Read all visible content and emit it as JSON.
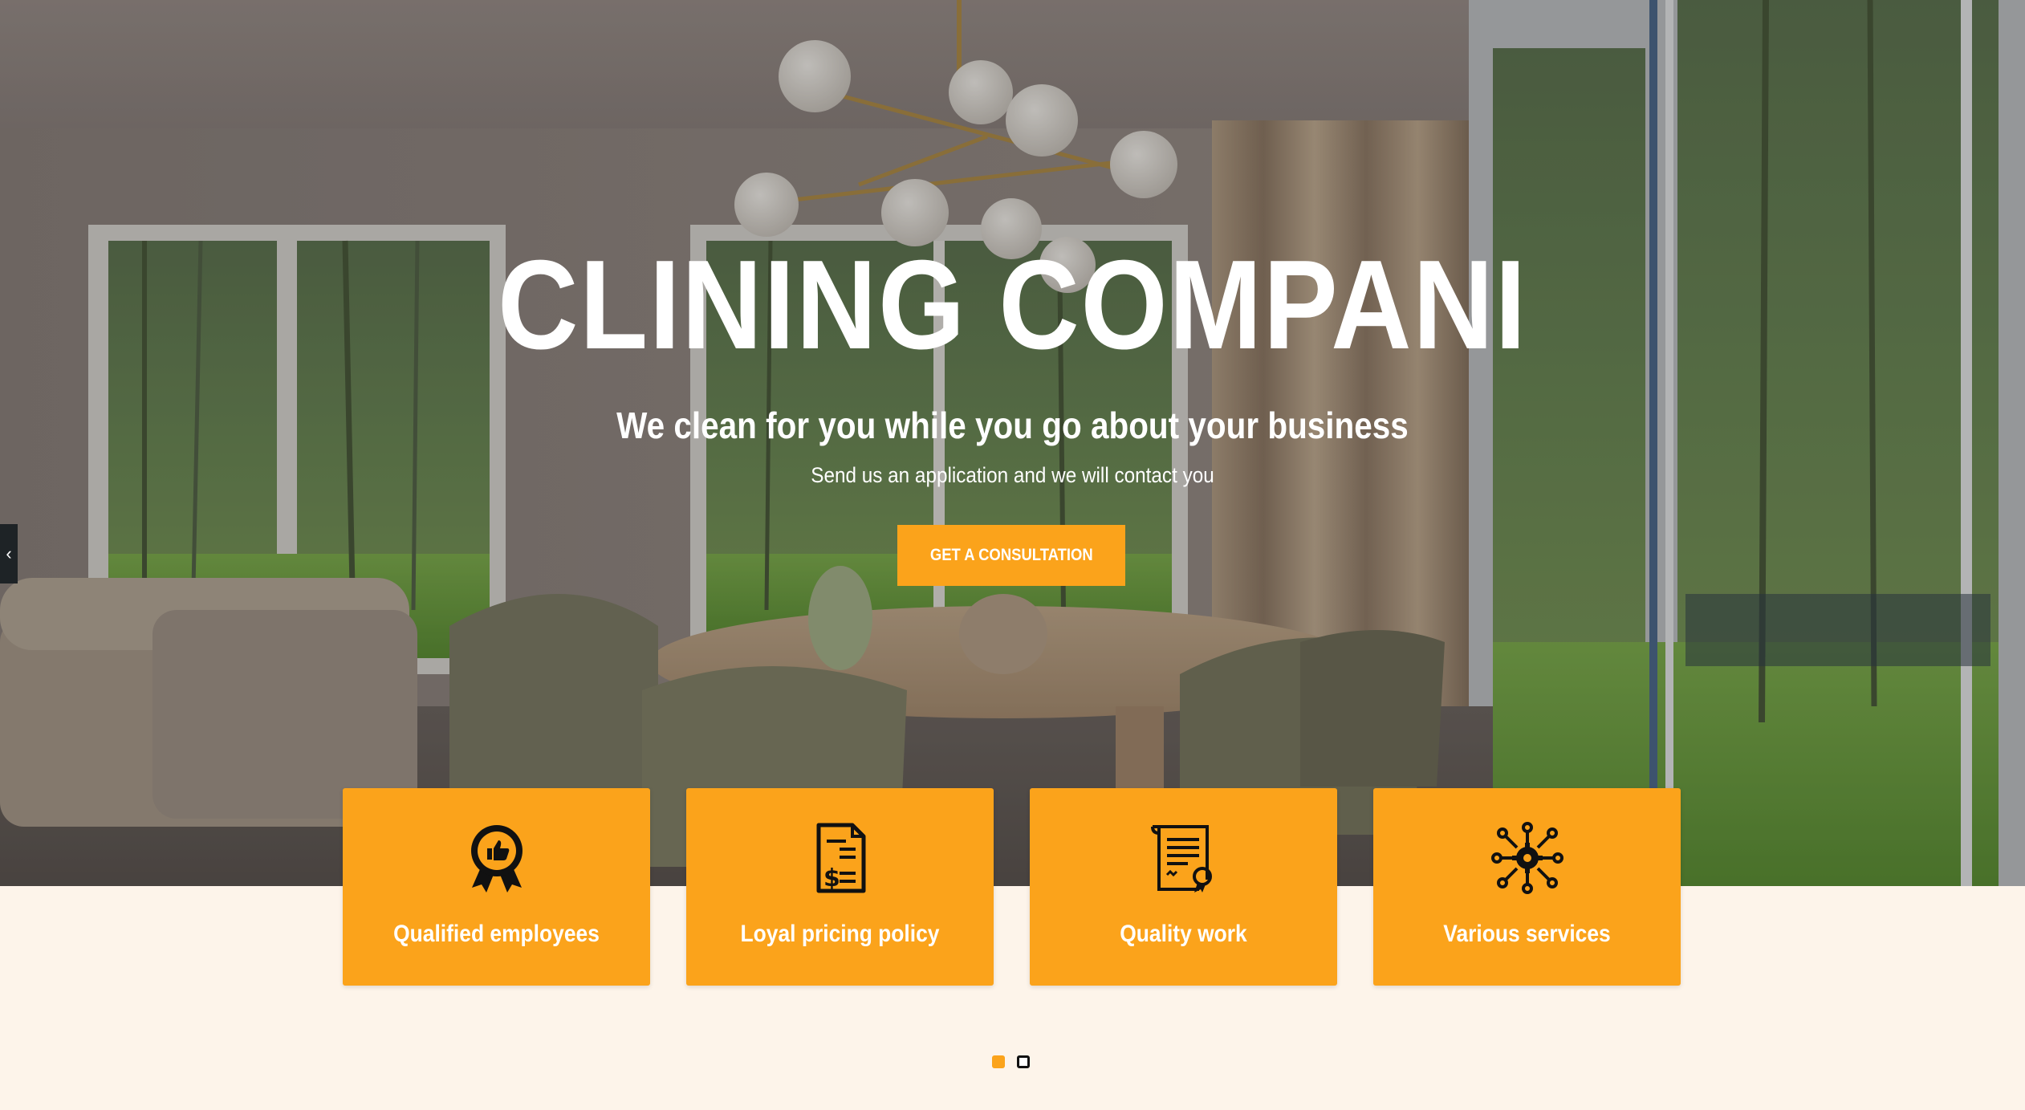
{
  "hero": {
    "title": "CLINING COMPANI",
    "subtitle": "We clean for you while you go about your business",
    "text": "Send us an application and we will contact you",
    "cta_label": "GET A CONSULTATION"
  },
  "slider": {
    "prev_arrow": "‹"
  },
  "features": [
    {
      "label": "Qualified employees",
      "icon": "award-ribbon-icon"
    },
    {
      "label": "Loyal pricing policy",
      "icon": "price-document-icon"
    },
    {
      "label": "Quality work",
      "icon": "certificate-scroll-icon"
    },
    {
      "label": "Various services",
      "icon": "gear-network-icon"
    }
  ],
  "pagination": {
    "count": 2,
    "active_index": 0
  },
  "colors": {
    "accent": "#fba31b",
    "page_background": "#fdf4ea",
    "text_light": "#ffffff",
    "icon_dark": "#111111"
  }
}
